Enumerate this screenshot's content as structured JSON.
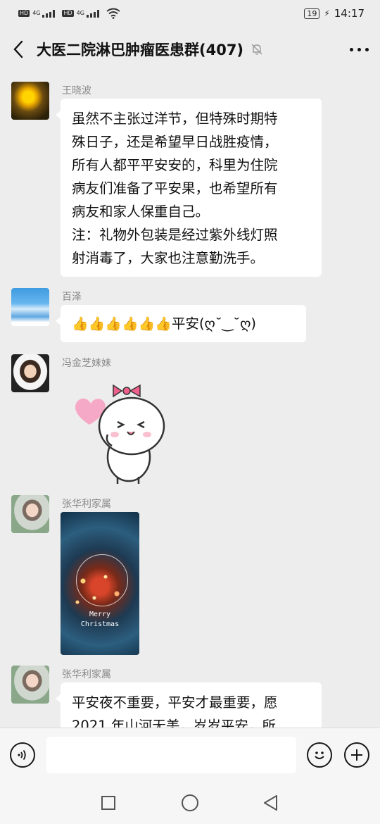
{
  "status": {
    "sig1": "HD",
    "sig2": "HD",
    "net1": "4G",
    "net2": "4G",
    "battery": "19",
    "time": "14:17"
  },
  "header": {
    "title": "大医二院淋巴肿瘤医患群(407)"
  },
  "messages": [
    {
      "sender": "王晓波",
      "lines": [
        "虽然不主张过洋节，但特殊时期特",
        "殊日子，还是希望早日战胜疫情，",
        "所有人都平平安安的，科里为住院",
        "病友们准备了平安果，也希望所有",
        "病友和家人保重自己。",
        "注：礼物外包装是经过紫外线灯照",
        "射消毒了，大家也注意勤洗手。"
      ]
    },
    {
      "sender": "百泽",
      "thumbs": "👍👍👍👍👍👍",
      "text": "平安(ღ˘‿˘ღ)"
    },
    {
      "sender": "冯金芝妹妹"
    },
    {
      "sender": "张华利家属",
      "image_text_1": "Merry",
      "image_text_2": "Christmas"
    },
    {
      "sender": "张华利家属",
      "lines": [
        "平安夜不重要，平安才最重要，愿",
        "2021 年山河无恙，岁岁平安，所"
      ]
    }
  ],
  "input": {
    "placeholder": ""
  },
  "icons": [
    "back-icon",
    "mute-bell-icon",
    "more-icon",
    "voice-icon",
    "emoji-icon",
    "plus-icon",
    "recent-apps-icon",
    "home-icon",
    "back-triangle-icon"
  ]
}
